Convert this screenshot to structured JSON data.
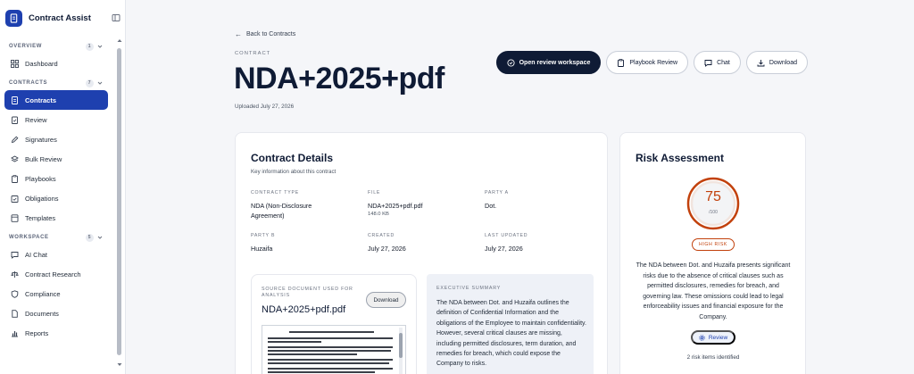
{
  "app": {
    "name": "Contract Assist"
  },
  "sidebar": {
    "sections": [
      {
        "label": "OVERVIEW",
        "count": "1",
        "items": [
          {
            "label": "Dashboard",
            "icon": "grid-icon"
          }
        ]
      },
      {
        "label": "CONTRACTS",
        "count": "7",
        "items": [
          {
            "label": "Contracts",
            "icon": "document-icon",
            "active": true
          },
          {
            "label": "Review",
            "icon": "clipboard-check-icon"
          },
          {
            "label": "Signatures",
            "icon": "pen-icon"
          },
          {
            "label": "Bulk Review",
            "icon": "layers-icon"
          },
          {
            "label": "Playbooks",
            "icon": "clipboard-icon"
          },
          {
            "label": "Obligations",
            "icon": "calendar-check-icon"
          },
          {
            "label": "Templates",
            "icon": "template-icon"
          }
        ]
      },
      {
        "label": "WORKSPACE",
        "count": "5",
        "items": [
          {
            "label": "AI Chat",
            "icon": "chat-icon"
          },
          {
            "label": "Contract Research",
            "icon": "scale-icon"
          },
          {
            "label": "Compliance",
            "icon": "shield-icon"
          },
          {
            "label": "Documents",
            "icon": "file-icon"
          },
          {
            "label": "Reports",
            "icon": "bar-chart-icon"
          }
        ]
      }
    ]
  },
  "header": {
    "back_label": "Back to Contracts",
    "eyebrow": "CONTRACT",
    "title": "NDA+2025+pdf",
    "uploaded": "Uploaded July 27, 2026"
  },
  "actions": {
    "open_review": "Open review workspace",
    "playbook_review": "Playbook Review",
    "chat": "Chat",
    "download": "Download"
  },
  "details": {
    "title": "Contract Details",
    "subtitle": "Key information about this contract",
    "fields": {
      "contract_type_label": "CONTRACT TYPE",
      "contract_type_value": "NDA (Non-Disclosure Agreement)",
      "file_label": "FILE",
      "file_value": "NDA+2025+pdf.pdf",
      "file_size": "148.0 KB",
      "party_a_label": "PARTY A",
      "party_a_value": "Dot.",
      "party_b_label": "PARTY B",
      "party_b_value": "Huzaifa",
      "created_label": "CREATED",
      "created_value": "July 27, 2026",
      "updated_label": "LAST UPDATED",
      "updated_value": "July 27, 2026"
    },
    "source": {
      "label": "SOURCE DOCUMENT USED FOR ANALYSIS",
      "filename": "NDA+2025+pdf.pdf",
      "download": "Download"
    },
    "executive_summary": {
      "label": "EXECUTIVE SUMMARY",
      "text": "The NDA between Dot. and Huzaifa outlines the definition of Confidential Information and the obligations of the Employee to maintain confidentiality. However, several critical clauses are missing, including permitted disclosures, term duration, and remedies for breach, which could expose the Company to risks."
    }
  },
  "risk": {
    "title": "Risk Assessment",
    "score": "75",
    "score_max": "/100",
    "score_fraction": 0.75,
    "level": "HIGH RISK",
    "summary": "The NDA between Dot. and Huzaifa presents significant risks due to the absence of critical clauses such as permitted disclosures, remedies for breach, and governing law. These omissions could lead to legal enforceability issues and financial exposure for the Company.",
    "review_label": "Review",
    "items_identified": "2 risk items identified"
  },
  "colors": {
    "primary": "#1e40af",
    "dark": "#0f1b35",
    "risk": "#c2410c"
  }
}
